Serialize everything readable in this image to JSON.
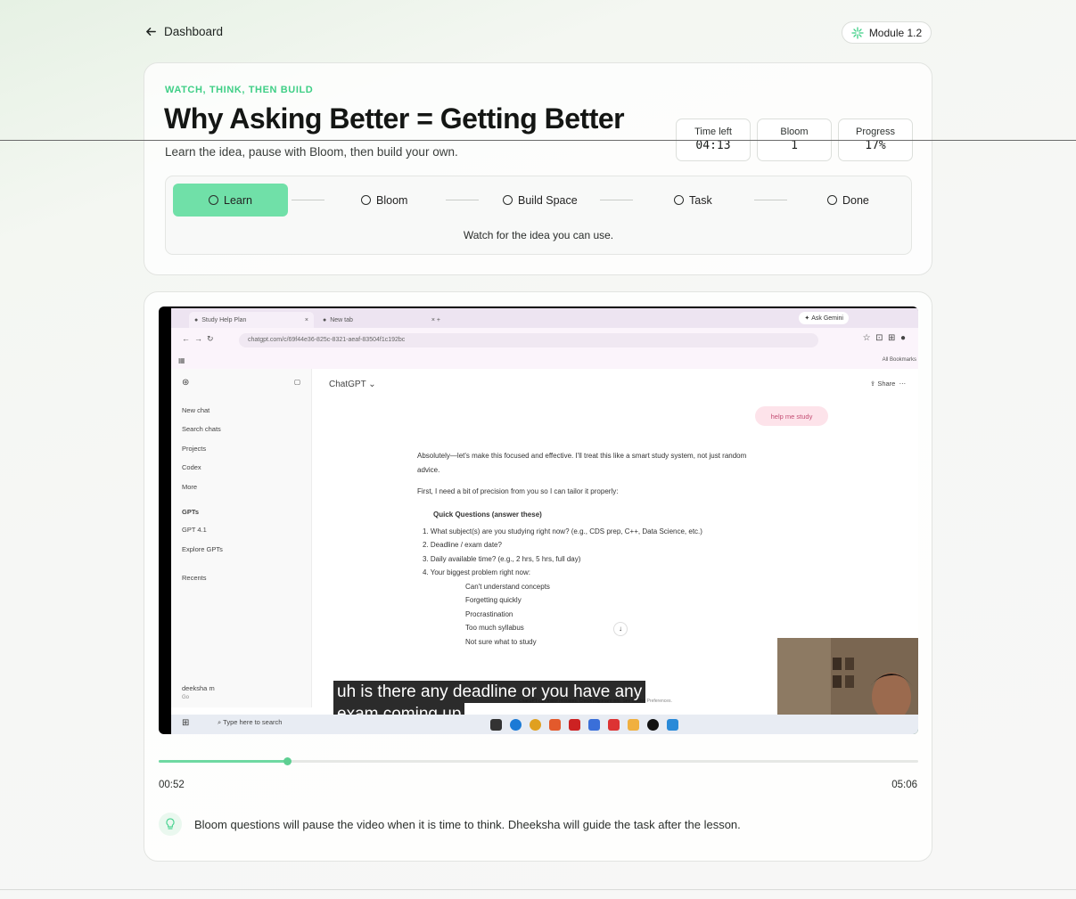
{
  "nav": {
    "back_label": "Dashboard",
    "module_label": "Module 1.2"
  },
  "header": {
    "eyebrow": "WATCH, THINK, THEN BUILD",
    "title": "Why Asking Better = Getting Better",
    "subtitle": "Learn the idea, pause with Bloom, then build your own."
  },
  "stats": [
    {
      "label": "Time left",
      "value": "04:13"
    },
    {
      "label": "Bloom",
      "value": "1"
    },
    {
      "label": "Progress",
      "value": "17%"
    }
  ],
  "steps": [
    {
      "label": "Learn",
      "active": true
    },
    {
      "label": "Bloom"
    },
    {
      "label": "Build Space"
    },
    {
      "label": "Task"
    },
    {
      "label": "Done"
    }
  ],
  "steps_note": "Watch for the idea you can use.",
  "video": {
    "browser": {
      "tab1": "Study Help Plan",
      "tab2": "New tab",
      "ask_gemini": "Ask Gemini",
      "url": "chatgpt.com/c/69f44e36-825c-8321-aeaf-83504f1c192bc",
      "all_bookmarks": "All Bookmarks"
    },
    "sidebar": {
      "items": [
        "New chat",
        "Search chats",
        "Projects",
        "Codex",
        "More"
      ],
      "gpts_heading": "GPTs",
      "gpts": [
        "GPT 4.1",
        "Explore GPTs"
      ],
      "recents": "Recents",
      "user": "deeksha m",
      "user_plan": "Go"
    },
    "chat": {
      "model": "ChatGPT",
      "share": "Share",
      "user_message": "help me study",
      "lines": [
        "Absolutely—let's make this focused and effective. I'll treat this like a smart study system, not just random",
        "advice.",
        "First, I need a bit of precision from you so I can tailor it properly:",
        "Quick Questions (answer these)",
        "1. What subject(s) are you studying right now? (e.g., CDS prep, C++, Data Science, etc.)",
        "2. Deadline / exam date?",
        "3. Daily available time? (e.g., 2 hrs, 5 hrs, full day)",
        "4. Your biggest problem right now:",
        "Can't understand concepts",
        "Forgetting quickly",
        "Procrastination",
        "Too much syllabus",
        "Not sure what to study"
      ],
      "disclaimer": "ChatGPT can make mistakes. Check important info. See Cookie Preferences."
    },
    "taskbar_search": "Type here to search",
    "caption_line1": "uh is there any deadline or you have any",
    "caption_line2": "exam coming up",
    "progress_fraction": 0.17,
    "time_current": "00:52",
    "time_total": "05:06"
  },
  "hint": "Bloom questions will pause the video when it is time to think. Dheeksha will guide the task after the lesson.",
  "colors": {
    "accent": "#3fcf86",
    "active_step": "#70e0a8",
    "progress": "#6fd9a2"
  }
}
